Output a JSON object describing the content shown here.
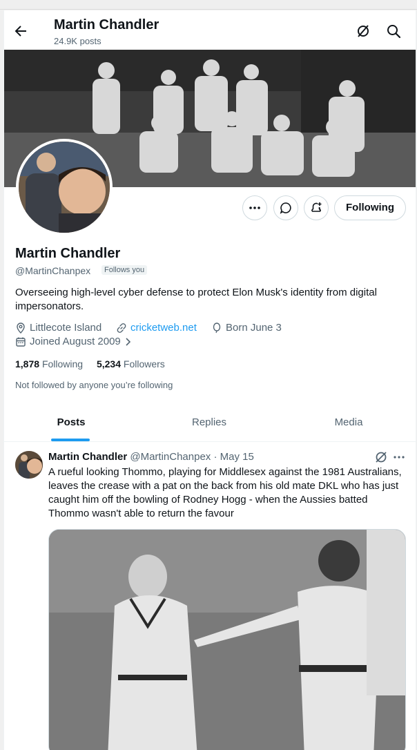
{
  "header": {
    "title": "Martin Chandler",
    "post_count": "24.9K posts"
  },
  "profile": {
    "name": "Martin Chandler",
    "handle": "@MartinChanpex",
    "follows_you": "Follows you",
    "bio": "Overseeing high-level cyber defense to protect Elon Musk's identity from digital impersonators.",
    "location": "Littlecote Island",
    "website": "cricketweb.net",
    "birthday": "Born June 3",
    "joined": "Joined August 2009",
    "following_count": "1,878",
    "following_label": "Following",
    "followers_count": "5,234",
    "followers_label": "Followers",
    "not_followed_note": "Not followed by anyone you’re following",
    "follow_button": "Following"
  },
  "tabs": [
    {
      "label": "Posts"
    },
    {
      "label": "Replies"
    },
    {
      "label": "Media"
    }
  ],
  "tweet": {
    "author": "Martin Chandler",
    "handle": "@MartinChanpex",
    "separator": "·",
    "date": "May 15",
    "text": "A rueful looking Thommo, playing for Middlesex against the 1981 Australians, leaves the crease with a pat on the back from his old mate DKL who has just caught him off the bowling of Rodney Hogg - when the Aussies batted Thommo wasn't able to return the favour"
  },
  "icons": {
    "back": "arrow-left-icon",
    "grok": "grok-icon",
    "search": "search-icon",
    "more": "more-icon",
    "message": "message-icon",
    "notify": "bell-plus-icon",
    "location": "location-icon",
    "link": "link-icon",
    "birthday": "balloon-icon",
    "calendar": "calendar-icon",
    "chevron": "chevron-right-icon"
  },
  "colors": {
    "accent": "#1d9bf0",
    "text": "#0f1419",
    "muted": "#536471"
  }
}
